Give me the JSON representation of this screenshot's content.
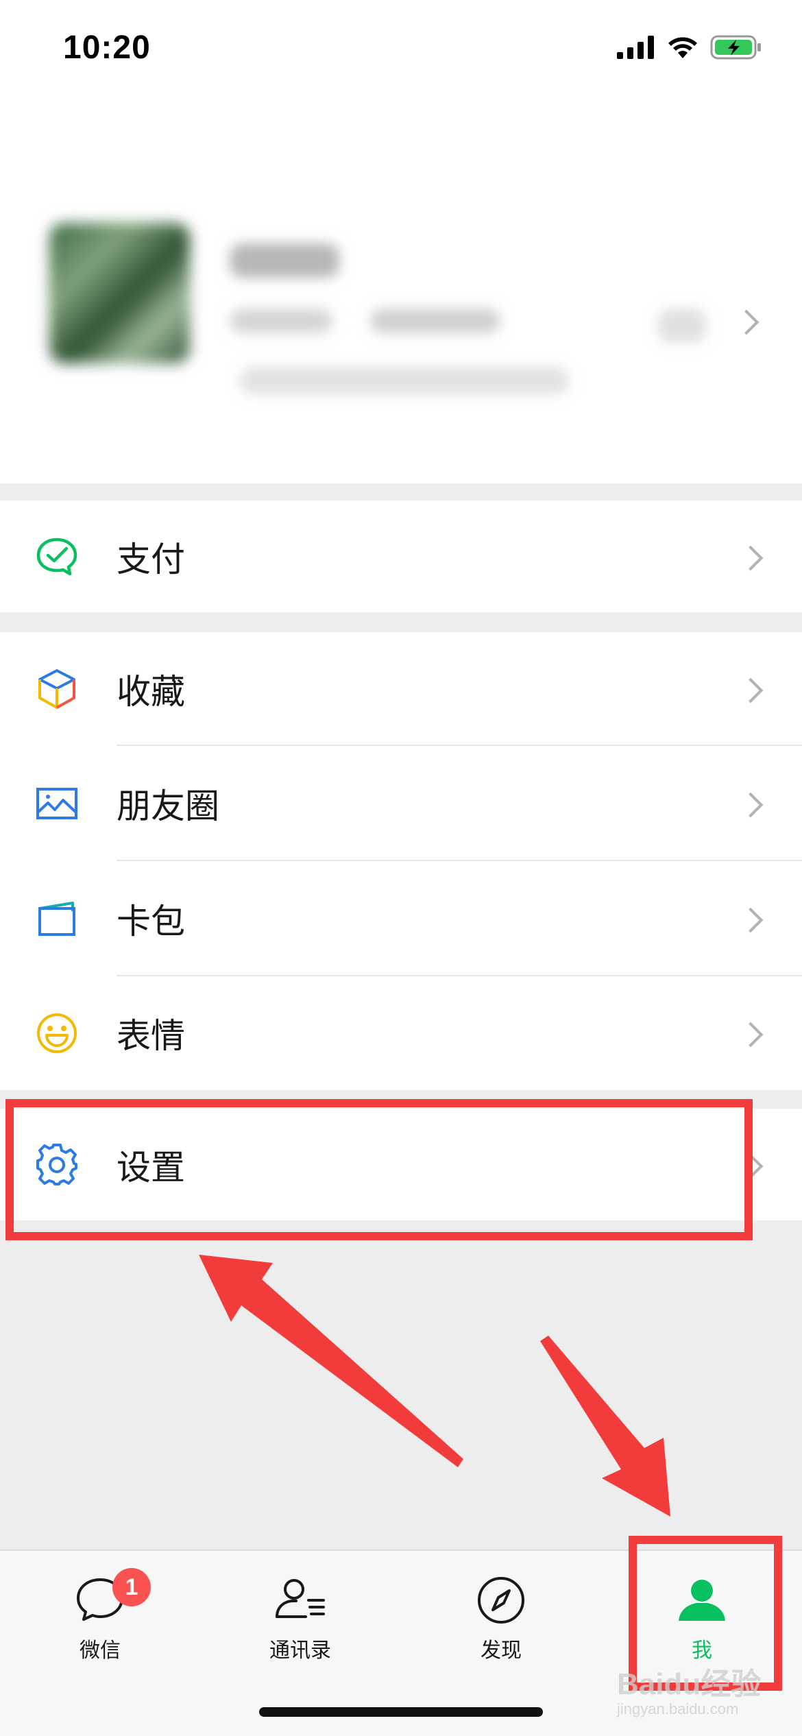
{
  "status_bar": {
    "time": "10:20"
  },
  "menu": {
    "pay": {
      "label": "支付",
      "icon": "pay-icon"
    },
    "favorites": {
      "label": "收藏",
      "icon": "favorites-cube-icon"
    },
    "moments": {
      "label": "朋友圈",
      "icon": "moments-photo-icon"
    },
    "card_wallet": {
      "label": "卡包",
      "icon": "card-wallet-icon"
    },
    "stickers": {
      "label": "表情",
      "icon": "smiley-icon"
    },
    "settings": {
      "label": "设置",
      "icon": "gear-icon"
    }
  },
  "tabbar": {
    "chats": {
      "label": "微信",
      "badge": "1",
      "icon": "chat-bubble-icon"
    },
    "contacts": {
      "label": "通讯录",
      "icon": "contacts-icon"
    },
    "discover": {
      "label": "发现",
      "icon": "compass-icon"
    },
    "me": {
      "label": "我",
      "icon": "person-icon",
      "active": true
    }
  },
  "watermark": {
    "brand": "Baidu经验",
    "url": "jingyan.baidu.com"
  },
  "colors": {
    "accent": "#07c160",
    "highlight": "#f23b3b",
    "badge": "#fa5151",
    "link_blue": "#2c7be5"
  }
}
